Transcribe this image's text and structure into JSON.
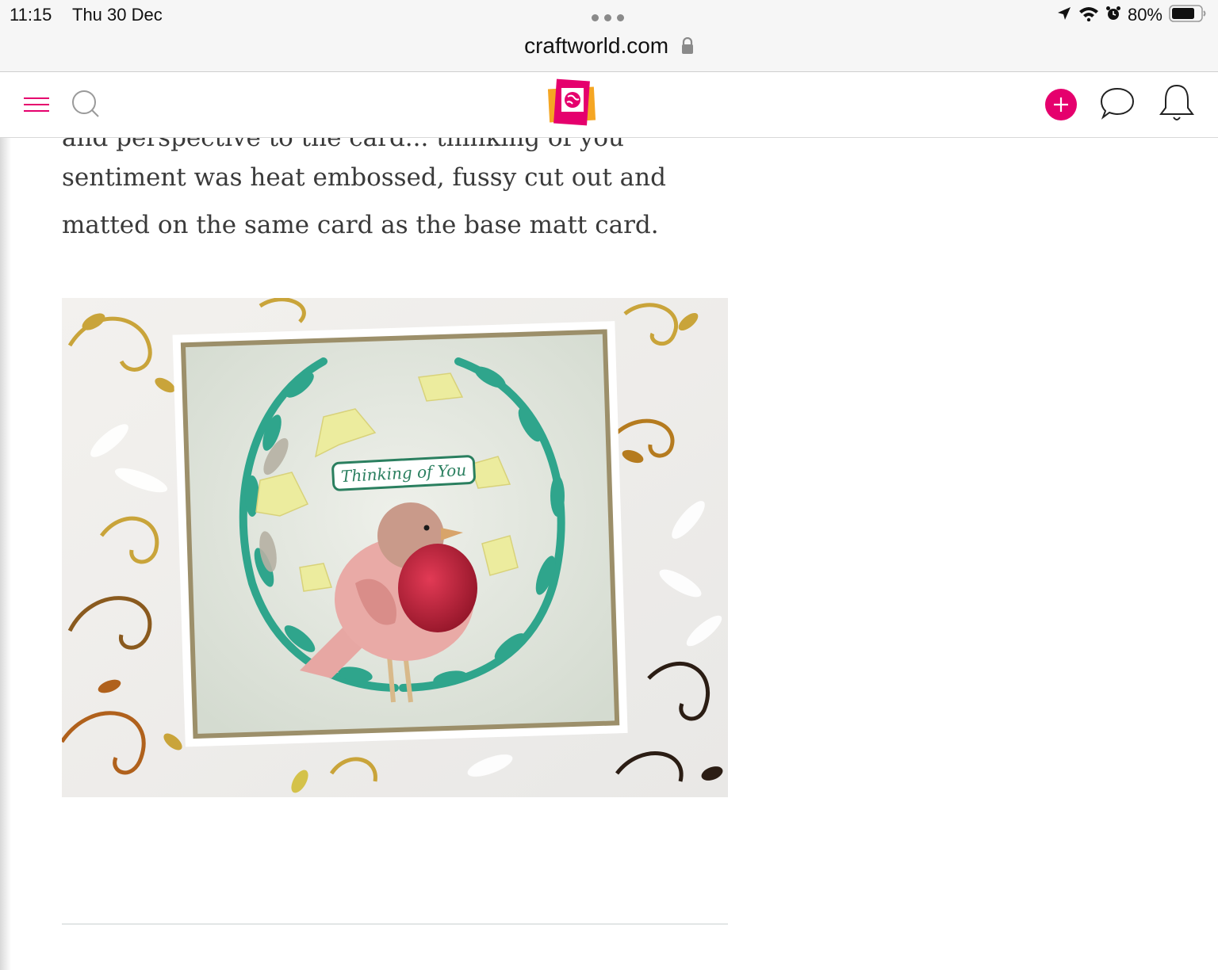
{
  "status_bar": {
    "time": "11:15",
    "date": "Thu 30 Dec",
    "battery_percent": "80%",
    "battery_level": 0.8,
    "icons": [
      "location-arrow-icon",
      "wifi-icon",
      "alarm-icon",
      "battery-icon"
    ]
  },
  "browser": {
    "url": "craftworld.com",
    "secure": true
  },
  "nav": {
    "menu_icon": "hamburger-menu-icon",
    "search_icon": "search-icon",
    "logo_icon": "craftworld-logo",
    "add_icon": "plus-icon",
    "chat_icon": "chat-bubble-icon",
    "notifications_icon": "bell-icon",
    "accent_color": "#e5006d"
  },
  "article": {
    "partial_line": "and perspective to the card... thinking of you",
    "lines": [
      "sentiment was heat embossed, fussy cut out and",
      "matted on the same card as the base matt card."
    ],
    "image_sentiment": "Thinking of You"
  }
}
